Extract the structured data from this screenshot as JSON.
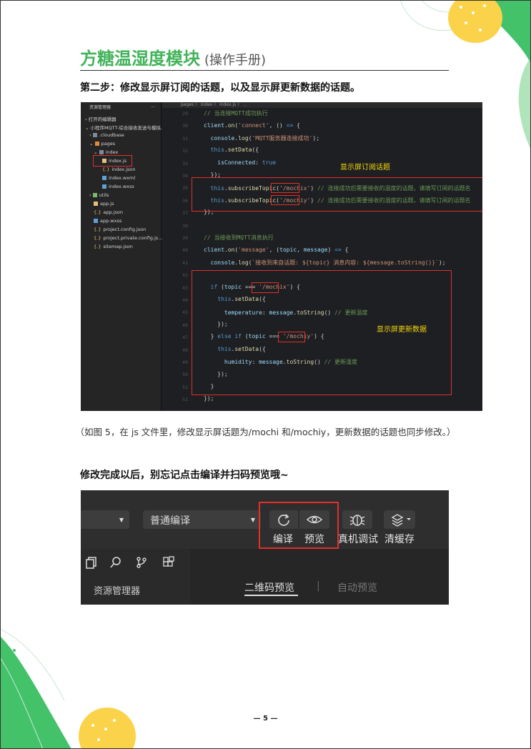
{
  "header": {
    "title": "方糖温湿度模块",
    "subtitle": "(操作手册)"
  },
  "step_heading": "第二步：修改显示屏订阅的话题，以及显示屏更新数据的话题。",
  "editor": {
    "explorer_title": "资源管理器",
    "explorer_dots": "...",
    "tree": [
      {
        "label": "打开的编辑器"
      },
      {
        "label": "小程序MQTT-综合接收发送与模拟..."
      },
      {
        "label": ".cloudbase"
      },
      {
        "label": "pages"
      },
      {
        "label": "index"
      },
      {
        "label": "index.js"
      },
      {
        "label": "index.json"
      },
      {
        "label": "index.wxml"
      },
      {
        "label": "index.wxss"
      },
      {
        "label": "utils"
      },
      {
        "label": "app.js"
      },
      {
        "label": "app.json"
      },
      {
        "label": "app.wxss"
      },
      {
        "label": "project.config.json"
      },
      {
        "label": "project.private.config.js..."
      },
      {
        "label": "sitemap.json"
      }
    ],
    "breadcrumb": "pages 〉 index 〉 index.js 〉 ...",
    "line_numbers": [
      "29",
      "30",
      "31",
      "32",
      "33",
      "34",
      "35",
      "36",
      "37",
      "38",
      "39",
      "40",
      "41",
      "42",
      "43",
      "44",
      "45",
      "46",
      "47",
      "48",
      "49",
      "50",
      "51",
      "52"
    ],
    "annotation_subscribe": "显示屏订阅话题",
    "annotation_update": "显示屏更新数据"
  },
  "caption": "（如图 5，在 js 文件里，修改显示屏话题为/mochi 和/mochiy，更新数据的话题也同步修改。）",
  "step2_heading": "修改完成以后，别忘记点击编译并扫码预览哦~",
  "toolbar": {
    "compile_mode": "普通编译",
    "compile_label": "编译",
    "preview_label": "预览",
    "remote_debug_label": "真机调试",
    "clear_cache_label": "清缓存",
    "explorer_label": "资源管理器",
    "tab_qr": "二维码预览",
    "tab_separator": "|",
    "tab_auto": "自动预览"
  },
  "page_number": "— 5 —"
}
